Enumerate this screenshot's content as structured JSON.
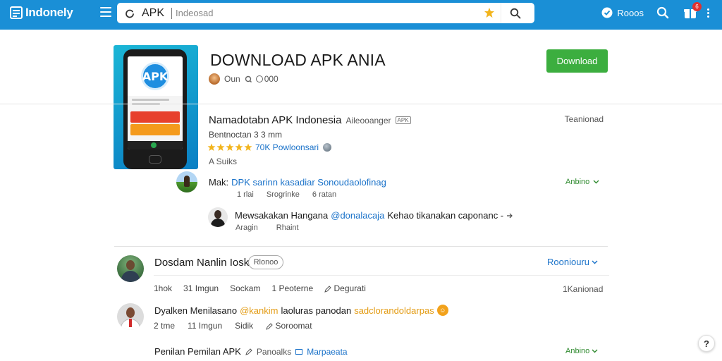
{
  "topbar": {
    "brand": "Indonely",
    "search_query": "APK",
    "search_placeholder": "Indeosad",
    "right_label": "Rooos",
    "gift_badge": "6"
  },
  "app": {
    "title": "DOWNLOAD APK ANIA",
    "developer_label": "Oun",
    "developer_chip": "000",
    "download_label": "Download"
  },
  "info": {
    "title": "Namadotabn APK Indonesia",
    "title_sub": "Aileooanger",
    "chip": "APK",
    "right": "Teanionad",
    "meta": "Bentnoctan  3  3 mm",
    "rating_text": "70K Powloonsari",
    "rating_sub": "A  Suiks"
  },
  "comment1": {
    "author": "Mak:",
    "text": "DPK sarinn kasadiar Sonoudaolofinag",
    "meta": [
      "1 rlai",
      "Srogrinke",
      "6 ratan"
    ],
    "right": "Anbino"
  },
  "comment2": {
    "author": "Mewsakakan Hangana",
    "handle": "@donalacaja",
    "text": "Kehao tikanakan caponanc -",
    "meta": [
      "Aragin",
      "Rhaint"
    ]
  },
  "review1": {
    "title": "Dosdam Nanlin Iosk",
    "chip": "Rlonoo",
    "link": "Rooniouru",
    "meta": [
      "1hok",
      "31 Imgun",
      "Sockam",
      "1 Peoterne",
      "Degurati"
    ],
    "right": "1Kanionad"
  },
  "review2": {
    "author": "Dyalken Menilasano",
    "highlight1": "@kankim",
    "middle": "laoluras panodan",
    "highlight2": "sadclorandoldarpas",
    "meta": [
      "2 tme",
      "11 Imgun",
      "Sidik",
      "Soroomat"
    ]
  },
  "review3": {
    "title": "Penilan Pemilan APK",
    "sub": "Panoalks",
    "link": "Marpaeata",
    "right": "Anbino"
  },
  "help": {
    "label": "?"
  },
  "colors": {
    "topbar": "#1a8fd6",
    "accent_green": "#3cae3f",
    "link_blue": "#1a72c9",
    "star": "#f2b41c"
  }
}
